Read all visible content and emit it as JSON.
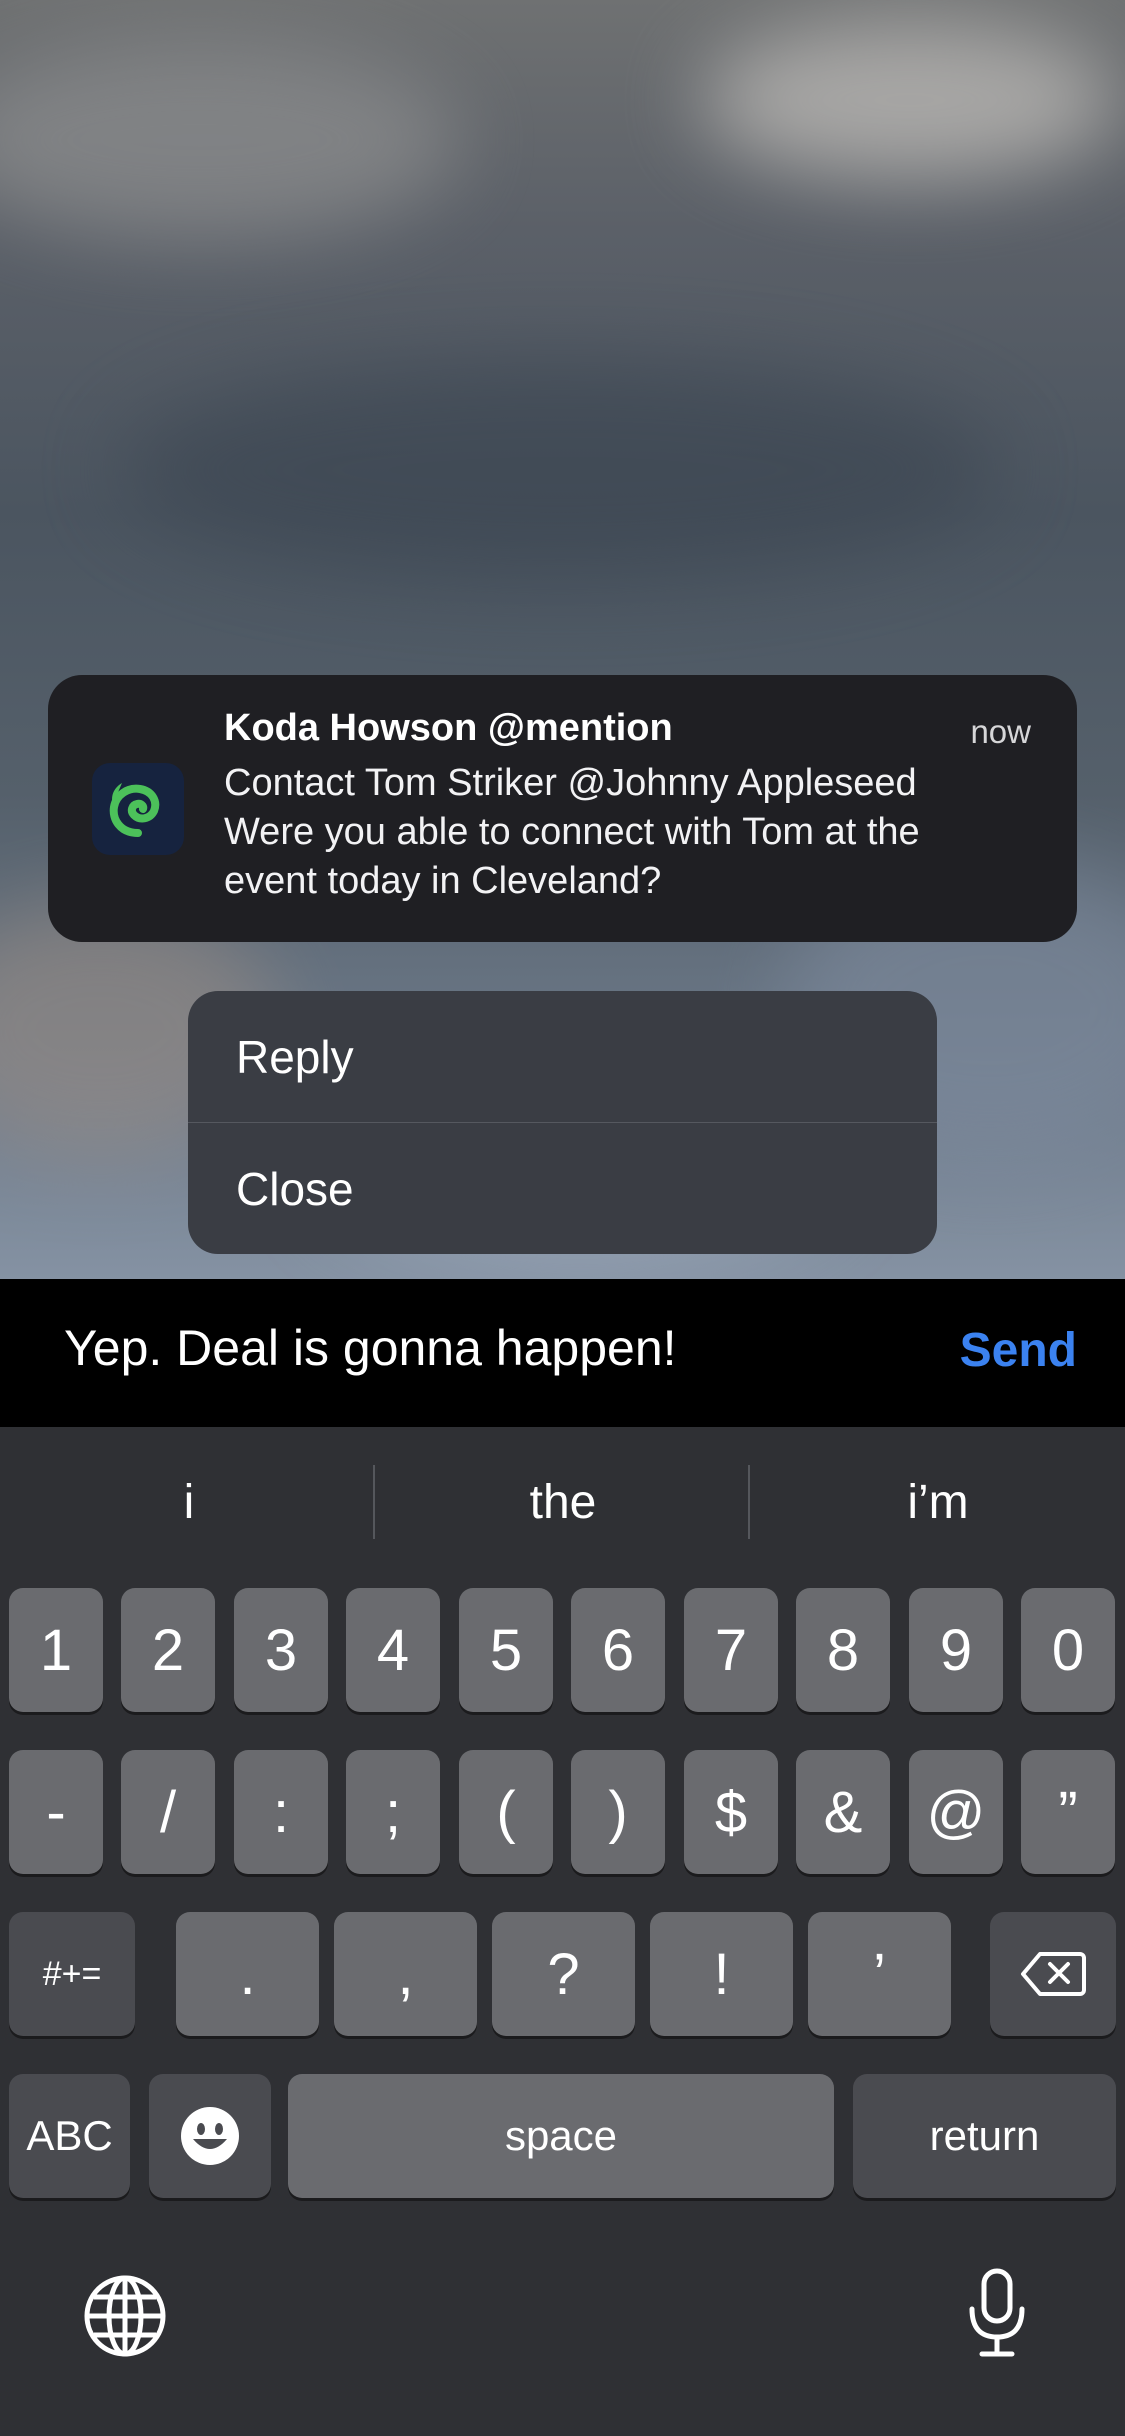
{
  "notification": {
    "title": "Koda Howson @mention",
    "time": "now",
    "body_lines": [
      "Contact Tom Striker @Johnny Appleseed",
      "Were you able to connect with Tom at the",
      "event today in Cleveland?"
    ],
    "app_icon": "swirl-logo-icon"
  },
  "actions": {
    "reply": "Reply",
    "close": "Close"
  },
  "reply_bar": {
    "text": "Yep. Deal is gonna happen!",
    "send_label": "Send"
  },
  "keyboard": {
    "predictions": [
      "i",
      "the",
      "i’m"
    ],
    "row1": [
      "1",
      "2",
      "3",
      "4",
      "5",
      "6",
      "7",
      "8",
      "9",
      "0"
    ],
    "row2": [
      "-",
      "/",
      ":",
      ";",
      "(",
      ")",
      "$",
      "&",
      "@",
      "”"
    ],
    "row3_toggle": "#+=",
    "row3": [
      ".",
      ",",
      "?",
      "!",
      "’"
    ],
    "abc_label": "ABC",
    "space_label": "space",
    "return_label": "return",
    "icons": {
      "emoji": "emoji-icon",
      "delete": "delete-icon",
      "globe": "globe-icon",
      "microphone": "microphone-icon"
    }
  },
  "colors": {
    "accent": "#3b82f0",
    "notification_bg": "#1f1f23",
    "key_bg": "#6a6b6f",
    "key_dark_bg": "#4a4b50"
  }
}
